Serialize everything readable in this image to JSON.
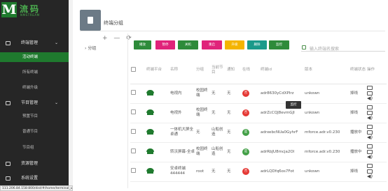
{
  "logo": {
    "mark": "M",
    "title": "流码",
    "subtitle": "NMSTREAM"
  },
  "sidebar": {
    "groups": [
      {
        "label": "终端管理",
        "icon": "terminal-icon",
        "chevron": "⌄",
        "items": [
          "活动终端",
          "所有终端",
          "终端升级"
        ],
        "active": 0
      },
      {
        "label": "节目管理",
        "icon": "program-icon",
        "chevron": "⌄",
        "items": [
          "预置节目",
          "普通节目",
          "节目组"
        ],
        "active": -1
      },
      {
        "label": "资源管理",
        "icon": "resource-icon",
        "chevron": "",
        "items": [],
        "active": -1
      },
      {
        "label": "系统设置",
        "icon": "settings-icon",
        "chevron": "",
        "items": [],
        "active": -1
      }
    ]
  },
  "status_url": "111.206.84.158:800/dist/#/home/terminal_update/",
  "page": {
    "title": "终端分组",
    "icon": "group-icon"
  },
  "tree": {
    "tools": "+ — ⟳",
    "root_label": "分组",
    "root_caret": "›"
  },
  "toolbar": {
    "buttons": [
      {
        "label": "播放",
        "color": "#2e8b3a"
      },
      {
        "label": "暂停",
        "color": "#e0237a"
      },
      {
        "label": "关机",
        "color": "#2e8b3a"
      },
      {
        "label": "重启",
        "color": "#e0237a"
      },
      {
        "label": "升级",
        "color": "#f4b400"
      },
      {
        "label": "删除",
        "color": "#1a9a8a"
      },
      {
        "label": "监控",
        "color": "#2e8b3a"
      }
    ],
    "search_placeholder": "输入终端名搜索"
  },
  "table": {
    "headers": [
      "终端平台",
      "名称",
      "分组",
      "当前节目",
      "通知",
      "在线",
      "终端id",
      "版本",
      "终端状态",
      "操作"
    ],
    "rows": [
      {
        "name": "电视内",
        "group": "校园终端",
        "program": "无",
        "notice": "无",
        "online": "否",
        "online_color": "#e53935",
        "id": "adr8630yCdXPIrz",
        "version": "unkown",
        "status": "掉线"
      },
      {
        "name": "电视外",
        "group": "校园终端",
        "program": "无",
        "notice": "无",
        "online": "否",
        "online_color": "#e53935",
        "id": "adrZcCQJ8evmGJI",
        "version": "unkown",
        "status": "掉线"
      },
      {
        "name": "一体机大屏全卓通",
        "group": "无",
        "program": "山船创造",
        "notice": "无",
        "online": "是",
        "online_color": "#43a047",
        "id": "adrxebcNUa0GyhrF",
        "version": "mforce.adr.v0.230",
        "status": "播放中"
      },
      {
        "name": "转沃屏幕-全卓",
        "group": "校园终端",
        "program": "山船创造",
        "notice": "无",
        "online": "是",
        "online_color": "#43a047",
        "id": "adrRbJU8mcja2Ol",
        "version": "mforce.adr.v0.230",
        "status": "播放中"
      },
      {
        "name": "安卓终端444444",
        "group": "root",
        "program": "无",
        "notice": "无",
        "online": "否",
        "online_color": "#e53935",
        "id": "adrLQDfq6os7Fot",
        "version": "unkown",
        "status": "掉线"
      }
    ]
  },
  "tooltip": "监控",
  "colors": {
    "brand_green": "#1f7a2e",
    "sidebar_bg": "#262626"
  }
}
